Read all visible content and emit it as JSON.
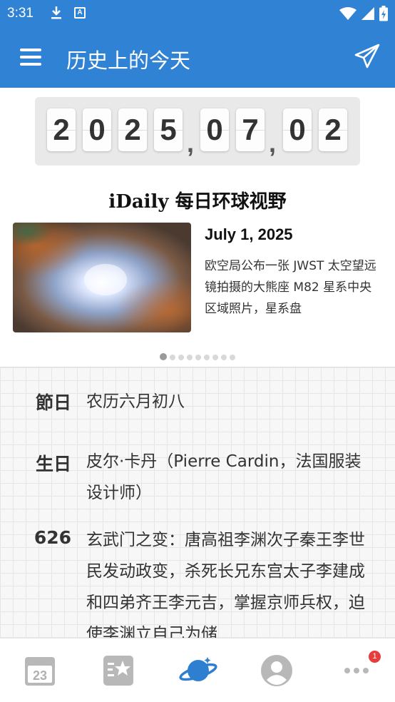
{
  "status_bar": {
    "time": "3:31",
    "icons": [
      "download-icon",
      "a-icon",
      "wifi-icon",
      "signal-icon",
      "battery-icon"
    ]
  },
  "app_bar": {
    "title": "历史上的今天",
    "left_icon": "menu-icon",
    "right_icon": "send-icon"
  },
  "date_display": {
    "digits": [
      "2",
      "0",
      "2",
      "5",
      "0",
      "7",
      "0",
      "2"
    ],
    "separator": ","
  },
  "idaily": {
    "brand": "iDaily 每日环球视野",
    "date": "July 1, 2025",
    "text": "欧空局公布一张 JWST 太空望远镜拍摄的大熊座 M82 星系中央区域照片，星系盘",
    "page_count": 9,
    "active_page": 0
  },
  "events": [
    {
      "label": "節日",
      "text": "农历六月初八"
    },
    {
      "label": "生日",
      "text": "皮尔·卡丹（Pierre Cardin，法国服装设计师）"
    },
    {
      "label": "626",
      "text": "玄武门之变：唐高祖李渊次子秦王李世民发动政变，杀死长兄东宫太子李建成和四弟齐王李元吉，掌握京师兵权，迫使李渊立自己为储"
    }
  ],
  "bottom_nav": {
    "items": [
      "calendar-icon",
      "favorites-icon",
      "planet-icon",
      "profile-icon",
      "more-icon"
    ],
    "active_index": 2,
    "badge": "1"
  },
  "colors": {
    "primary": "#2f82d4",
    "accent_planet": "#2f7fd0",
    "badge": "#e83b3b"
  }
}
